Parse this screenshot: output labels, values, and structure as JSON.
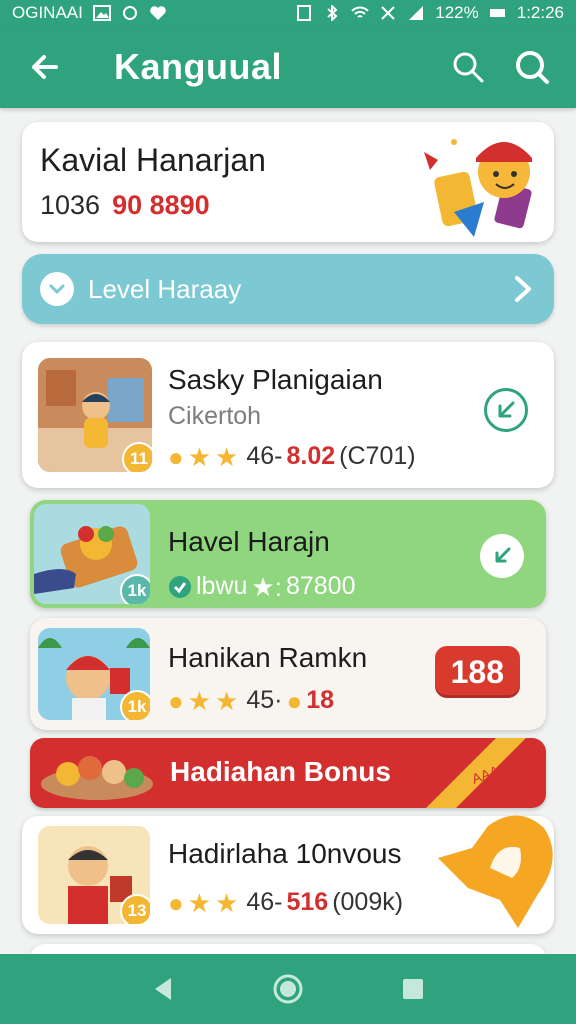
{
  "status_bar": {
    "carrier": "OGINAAI",
    "battery": "122%",
    "time": "1:2:26"
  },
  "app_bar": {
    "title": "Kanguual",
    "back_icon": "arrow-left-icon",
    "search_icon": "search-icon",
    "search2_icon": "search-icon"
  },
  "profile": {
    "name": "Kavial Hanarjan",
    "id": "1036",
    "points": "90 8890"
  },
  "level": {
    "label": "Level Haraay"
  },
  "items": [
    {
      "title": "Sasky Planigaian",
      "subtitle": "Cikertoh",
      "badge": "11",
      "rating": "46-",
      "price": "8.02",
      "extra": "(C701)"
    },
    {
      "title": "Havel Harajn",
      "badge": "1k",
      "tag": "lbwu",
      "price": "87800"
    },
    {
      "title": "Hanikan Ramkn",
      "badge": "1k",
      "rating": "45·",
      "price": "18",
      "amount": "188"
    },
    {
      "title": "Hadirlaha 10nvous",
      "badge": "13",
      "rating": "46-",
      "price": "516",
      "extra": "(009k)"
    }
  ],
  "bonus": {
    "label": "Hadiahan Bonus",
    "ribbon_text": "AAAAAA"
  },
  "colors": {
    "primary": "#2ea37e",
    "accent_red": "#d32f2f",
    "level_bar": "#7cc9d3",
    "green_card": "#8fd67e",
    "star": "#f4b733"
  }
}
